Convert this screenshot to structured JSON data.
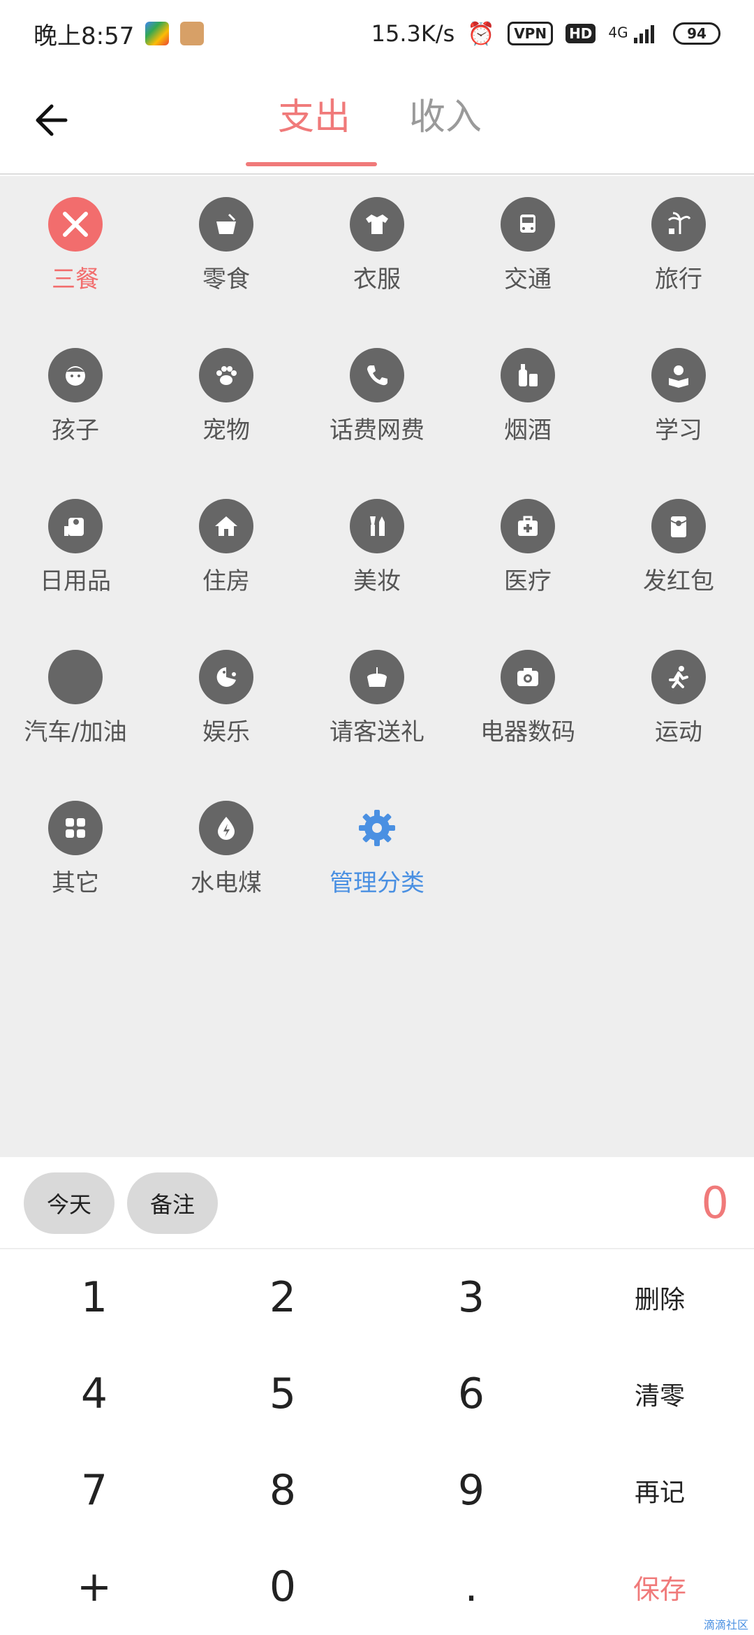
{
  "status_bar": {
    "time": "晚上8:57",
    "network_speed": "15.3K/s",
    "vpn": "VPN",
    "hd": "HD",
    "network": "4G",
    "battery": "94"
  },
  "header": {
    "tabs": [
      {
        "label": "支出",
        "active": true
      },
      {
        "label": "收入",
        "active": false
      }
    ]
  },
  "categories": [
    {
      "label": "三餐",
      "icon": "fork-knife-icon",
      "active": true
    },
    {
      "label": "零食",
      "icon": "snack-icon"
    },
    {
      "label": "衣服",
      "icon": "shirt-icon"
    },
    {
      "label": "交通",
      "icon": "bus-icon"
    },
    {
      "label": "旅行",
      "icon": "palm-tree-icon"
    },
    {
      "label": "孩子",
      "icon": "child-icon"
    },
    {
      "label": "宠物",
      "icon": "paw-icon"
    },
    {
      "label": "话费网费",
      "icon": "phone-icon"
    },
    {
      "label": "烟酒",
      "icon": "bottle-icon"
    },
    {
      "label": "学习",
      "icon": "reading-icon"
    },
    {
      "label": "日用品",
      "icon": "toilet-paper-icon"
    },
    {
      "label": "住房",
      "icon": "house-icon"
    },
    {
      "label": "美妆",
      "icon": "makeup-icon"
    },
    {
      "label": "医疗",
      "icon": "medkit-icon"
    },
    {
      "label": "发红包",
      "icon": "red-packet-icon"
    },
    {
      "label": "汽车/加油",
      "icon": "car-icon"
    },
    {
      "label": "娱乐",
      "icon": "game-icon"
    },
    {
      "label": "请客送礼",
      "icon": "gift-icon"
    },
    {
      "label": "电器数码",
      "icon": "camera-icon"
    },
    {
      "label": "运动",
      "icon": "running-icon"
    },
    {
      "label": "其它",
      "icon": "grid-icon"
    },
    {
      "label": "水电煤",
      "icon": "utilities-icon"
    }
  ],
  "manage": {
    "label": "管理分类",
    "icon": "gear-icon",
    "color": "#4a90e2"
  },
  "bottom_bar": {
    "today": "今天",
    "note": "备注",
    "amount": "0"
  },
  "keypad": [
    [
      "1",
      "2",
      "3",
      "删除"
    ],
    [
      "4",
      "5",
      "6",
      "清零"
    ],
    [
      "7",
      "8",
      "9",
      "再记"
    ],
    [
      "+",
      "0",
      ".",
      "保存"
    ]
  ],
  "colors": {
    "accent": "#f07a7a",
    "icon_bg": "#666666",
    "grid_bg": "#eeeeee",
    "manage": "#4a90e2"
  },
  "watermark": "滴滴社区"
}
